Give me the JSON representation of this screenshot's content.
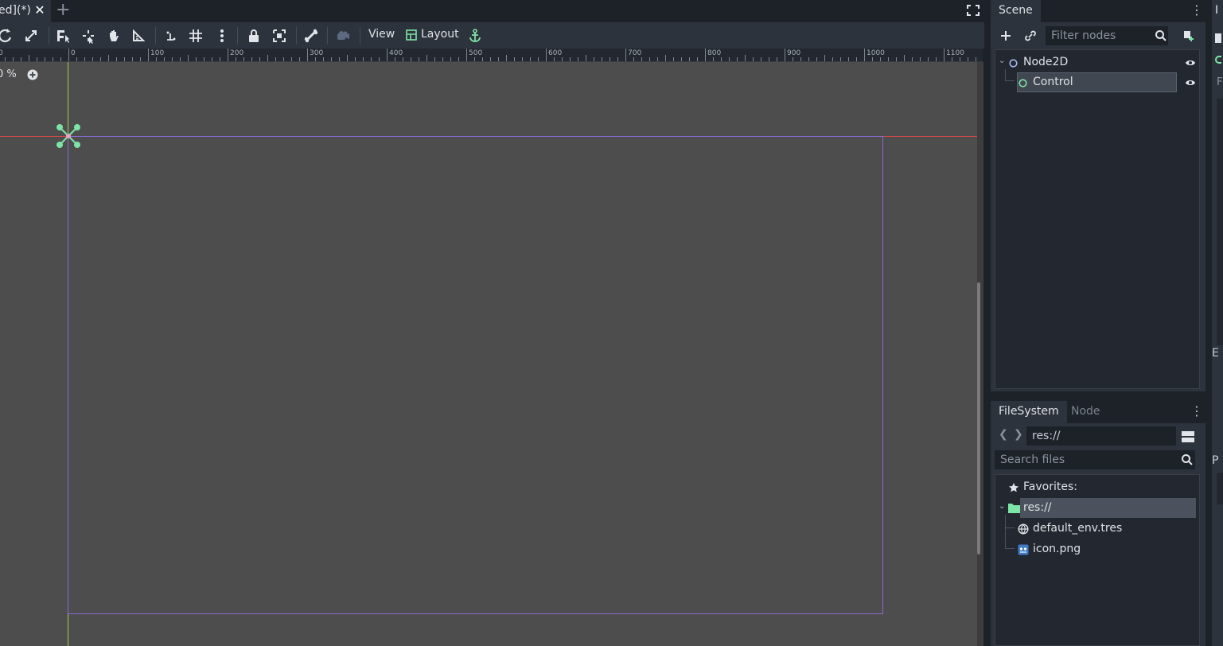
{
  "scene_tab": {
    "title": "ed](*)"
  },
  "toolbar": {
    "view_label": "View",
    "layout_label": "Layout"
  },
  "ruler": {
    "labels": [
      "0",
      "100",
      "200",
      "300",
      "400",
      "500",
      "600",
      "700",
      "800",
      "900",
      "1000",
      "1100"
    ]
  },
  "viewport": {
    "zoom_label": "0 %"
  },
  "scene_dock": {
    "tab_label": "Scene",
    "filter_placeholder": "Filter nodes",
    "nodes": [
      {
        "name": "Node2D"
      },
      {
        "name": "Control"
      }
    ]
  },
  "filesystem_dock": {
    "tab_filesystem": "FileSystem",
    "tab_node": "Node",
    "path_value": "res://",
    "search_placeholder": "Search files",
    "favorites_label": "Favorites:",
    "root_label": "res://",
    "files": [
      {
        "name": "default_env.tres"
      },
      {
        "name": "icon.png"
      }
    ]
  },
  "right_panel": {
    "tab_label": "I",
    "letter_e": "E",
    "letter_p": "P",
    "letter_f": "F"
  },
  "colors": {
    "accent_green": "#7de3a6",
    "x_axis": "#e04646",
    "y_axis": "#b6d66a",
    "control_rect": "#8a6bd1"
  }
}
